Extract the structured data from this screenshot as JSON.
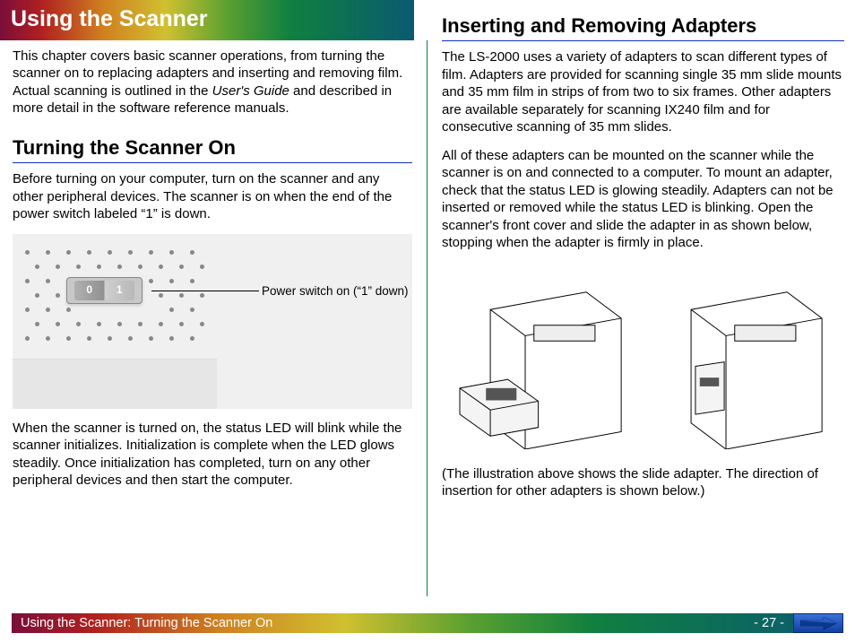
{
  "header": {
    "title": "Using the Scanner"
  },
  "left": {
    "intro_html": "This chapter covers basic scanner operations, from turning the scanner on to replacing adapters and inserting and removing film.  Actual scanning is outlined in the <em>User's Guide</em> and described in more detail in the software reference manuals.",
    "section1": {
      "title": "Turning the Scanner On",
      "p1": "Before turning on your computer, turn on the scanner and any other peripheral devices.  The scanner is on when the end of the power switch labeled “1” is down.",
      "callout": "Power switch on (“1” down)",
      "switch_labels": {
        "off": "0",
        "on": "1"
      },
      "p2": "When the scanner is turned on, the status LED will blink while the scanner initializes.  Initialization is complete when the LED glows steadily.  Once initialization has completed, turn on any other peripheral devices and then start the computer."
    }
  },
  "right": {
    "section2": {
      "title": "Inserting and Removing Adapters",
      "p1": "The LS-2000 uses a variety of adapters to scan different types of film.  Adapters are provided for scanning single 35 mm slide mounts and 35 mm film in strips of from two to six frames.  Other adapters are available separately for scanning IX240 film and for consecutive scanning of 35 mm slides.",
      "p2": "All of these adapters can be mounted on the scanner while the scanner is on and connected to a computer.  To mount an adapter, check that the status LED is glowing steadily.  Adapters can not be inserted or removed while the status LED is blinking.  Open the scanner's front cover and slide the adapter in as shown below, stopping when the adapter is firmly in place.",
      "caption": "(The illustration above shows the slide adapter.  The direction of insertion for other adapters is shown below.)"
    }
  },
  "footer": {
    "breadcrumb": "Using the Scanner:  Turning the Scanner On",
    "page": "- 27 -"
  }
}
